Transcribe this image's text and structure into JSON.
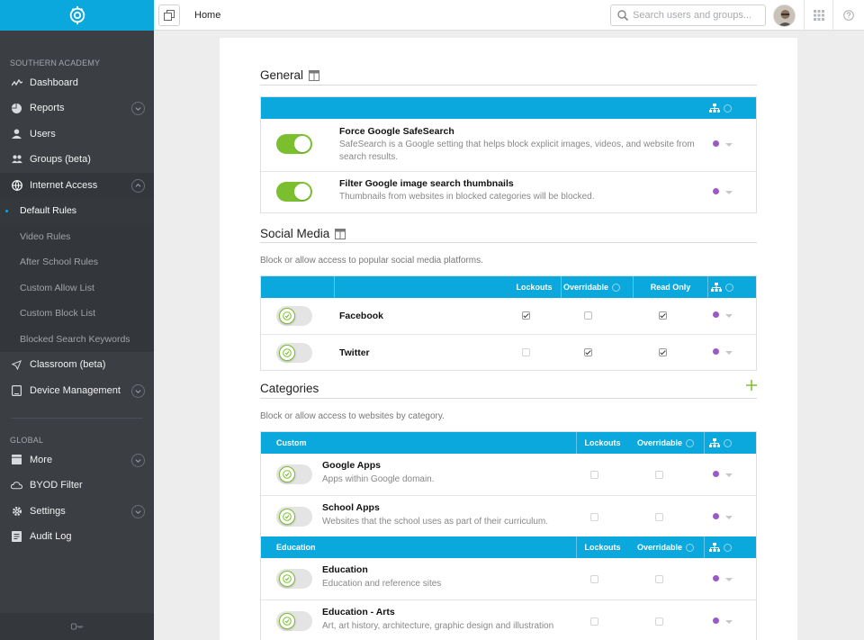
{
  "sidebar": {
    "org_label": "SOUTHERN ACADEMY",
    "items": [
      {
        "label": "Dashboard",
        "icon": "activity-icon"
      },
      {
        "label": "Reports",
        "icon": "pie-chart-icon"
      },
      {
        "label": "Users",
        "icon": "user-icon"
      },
      {
        "label": "Groups (beta)",
        "icon": "users-icon"
      },
      {
        "label": "Internet Access",
        "icon": "globe-icon"
      }
    ],
    "sub_items": [
      "Default Rules",
      "Video Rules",
      "After School Rules",
      "Custom Allow List",
      "Custom Block List",
      "Blocked Search Keywords"
    ],
    "items2": [
      {
        "label": "Classroom (beta)",
        "icon": "send-icon"
      },
      {
        "label": "Device Management",
        "icon": "tablet-icon"
      }
    ],
    "global_label": "GLOBAL",
    "global_items": [
      {
        "label": "More",
        "icon": "folder-icon"
      },
      {
        "label": "BYOD Filter",
        "icon": "cloud-icon"
      },
      {
        "label": "Settings",
        "icon": "gear-icon"
      },
      {
        "label": "Audit Log",
        "icon": "log-icon"
      }
    ]
  },
  "topbar": {
    "title": "Home",
    "search_placeholder": "Search users and groups..."
  },
  "general": {
    "title": "General",
    "rows": [
      {
        "title": "Force Google SafeSearch",
        "desc": "SafeSearch is a Google setting that helps block explicit images, videos, and website from search results."
      },
      {
        "title": "Filter Google image search thumbnails",
        "desc": "Thumbnails from websites in blocked categories will be blocked."
      }
    ]
  },
  "social": {
    "title": "Social Media",
    "desc": "Block or allow access to popular social media platforms.",
    "headers": {
      "lockouts": "Lockouts",
      "overridable": "Overridable",
      "read_only": "Read Only"
    },
    "rows": [
      {
        "name": "Facebook",
        "lockouts": true,
        "overridable": false,
        "read_only": true
      },
      {
        "name": "Twitter",
        "lockouts": false,
        "overridable": true,
        "read_only": true
      }
    ]
  },
  "categories": {
    "title": "Categories",
    "desc": "Block or allow access to websites by category.",
    "headers": {
      "lockouts": "Lockouts",
      "overridable": "Overridable"
    },
    "groups": [
      {
        "name": "Custom",
        "rows": [
          {
            "title": "Google Apps",
            "desc": "Apps within Google domain."
          },
          {
            "title": "School Apps",
            "desc": "Websites that the school uses as part of their curriculum."
          }
        ]
      },
      {
        "name": "Education",
        "rows": [
          {
            "title": "Education",
            "desc": "Education and reference sites"
          },
          {
            "title": "Education - Arts",
            "desc": "Art, art history, architecture, graphic design and illustration"
          }
        ]
      }
    ]
  },
  "colors": {
    "accent": "#0aa8dc",
    "toggle_on": "#7bbf2f",
    "sidebar": "#3b3e43",
    "dot": "#9b59c4"
  }
}
